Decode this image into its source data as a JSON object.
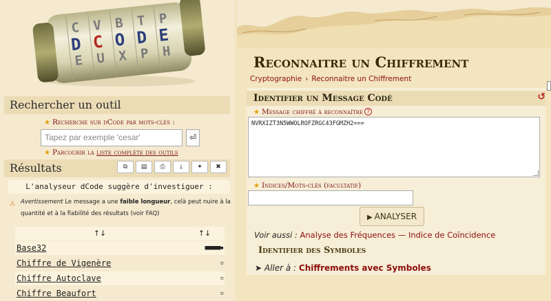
{
  "logo": {
    "brand": "DCODE"
  },
  "search": {
    "heading": "Rechercher un outil",
    "hint": "Recherche sur dCode par mots-clés :",
    "placeholder": "Tapez par exemple 'cesar'",
    "go_icon": "enter-icon",
    "browse_prefix": "Parcourir la",
    "browse_link": "liste complète des outils"
  },
  "results": {
    "heading": "Résultats",
    "tools": [
      "copy-icon",
      "save-icon",
      "print-icon",
      "download-icon",
      "pin-icon",
      "close-icon"
    ],
    "analyst_text": "L'analyseur dCode suggère d'investiguer :",
    "warning_label": "Avertissement",
    "warning_text_1": "Le message a une",
    "warning_bold": "faible longueur",
    "warning_text_2": ", celà peut nuire à la quantité et à la fiabilité des résultats (voir FAQ)",
    "sort_icon": "↑↓",
    "rows": [
      {
        "name": "Base32",
        "score": "■■■■■▪"
      },
      {
        "name": "Chiffre de Vigenère",
        "score": "▫"
      },
      {
        "name": "Chiffre Autoclave",
        "score": "▫"
      },
      {
        "name": "Chiffre Beaufort",
        "score": "▫"
      }
    ]
  },
  "main": {
    "title": "Reconnaitre un Chiffrement",
    "breadcrumb": [
      "Cryptographie",
      "Reconnaitre un Chiffrement"
    ],
    "panel_title": "Identifier un Message Codé",
    "message_label": "Message chiffré à reconnaître",
    "message_value": "NVRXIZT3N5WWOLROFZRGC43FGMZH2===",
    "keys_label": "Indices/Mots-clés (facultatif)",
    "keys_value": "",
    "analyse_label": "ANALYSER",
    "see_also_prefix": "Voir aussi :",
    "see_also_link1": "Analyse des Fréquences",
    "see_also_sep": "—",
    "see_also_link2": "Indice de Coïncidence",
    "symbols_title": "Identifier des Symboles",
    "goto_prefix": "➤ Aller à :",
    "goto_link": "Chiffrements avec Symboles"
  },
  "colors": {
    "accent_red": "#8b0d0d",
    "section_bar": "#ecdcb6",
    "parchment": "#f3e5bf",
    "title_brown": "#3b2a08"
  }
}
